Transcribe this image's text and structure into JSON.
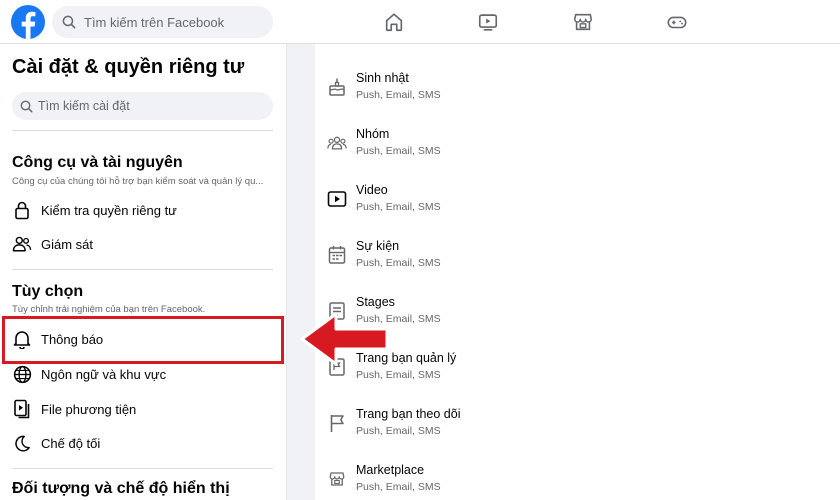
{
  "topbar": {
    "search_placeholder": "Tìm kiếm trên Facebook",
    "nav_icons": [
      "home-icon",
      "video-icon",
      "marketplace-icon",
      "gaming-icon"
    ]
  },
  "sidebar": {
    "title": "Cài đặt & quyền riêng tư",
    "search_placeholder": "Tìm kiếm cài đặt",
    "sections": [
      {
        "title": "Công cụ và tài nguyên",
        "description": "Công cụ của chúng tôi hỗ trợ bạn kiểm soát và quản lý qu...",
        "items": [
          {
            "label": "Kiểm tra quyền riêng tư",
            "icon": "lock-icon"
          },
          {
            "label": "Giám sát",
            "icon": "supervision-icon"
          }
        ]
      },
      {
        "title": "Tùy chọn",
        "description": "Tùy chỉnh trải nghiệm của bạn trên Facebook.",
        "items": [
          {
            "label": "Thông báo",
            "icon": "bell-icon",
            "highlighted": true
          },
          {
            "label": "Ngôn ngữ và khu vực",
            "icon": "globe-icon"
          },
          {
            "label": "File phương tiện",
            "icon": "media-file-icon"
          },
          {
            "label": "Chế độ tối",
            "icon": "moon-icon"
          }
        ]
      },
      {
        "title": "Đối tượng và chế độ hiển thị"
      }
    ]
  },
  "notifications": {
    "items": [
      {
        "title": "Sinh nhật",
        "channels": "Push, Email, SMS",
        "icon": "birthday-cake-icon"
      },
      {
        "title": "Nhóm",
        "channels": "Push, Email, SMS",
        "icon": "groups-icon"
      },
      {
        "title": "Video",
        "channels": "Push, Email, SMS",
        "icon": "video-icon"
      },
      {
        "title": "Sự kiện",
        "channels": "Push, Email, SMS",
        "icon": "calendar-icon"
      },
      {
        "title": "Stages",
        "channels": "Push, Email, SMS",
        "icon": "stages-icon"
      },
      {
        "title": "Trang bạn quản lý",
        "channels": "Push, Email, SMS",
        "icon": "managed-page-icon"
      },
      {
        "title": "Trang bạn theo dõi",
        "channels": "Push, Email, SMS",
        "icon": "flag-icon"
      },
      {
        "title": "Marketplace",
        "channels": "Push, Email, SMS",
        "icon": "marketplace-icon"
      }
    ]
  },
  "colors": {
    "facebook_blue": "#1877f2",
    "annotation_red": "#d71a21",
    "text_secondary": "#65676b"
  }
}
